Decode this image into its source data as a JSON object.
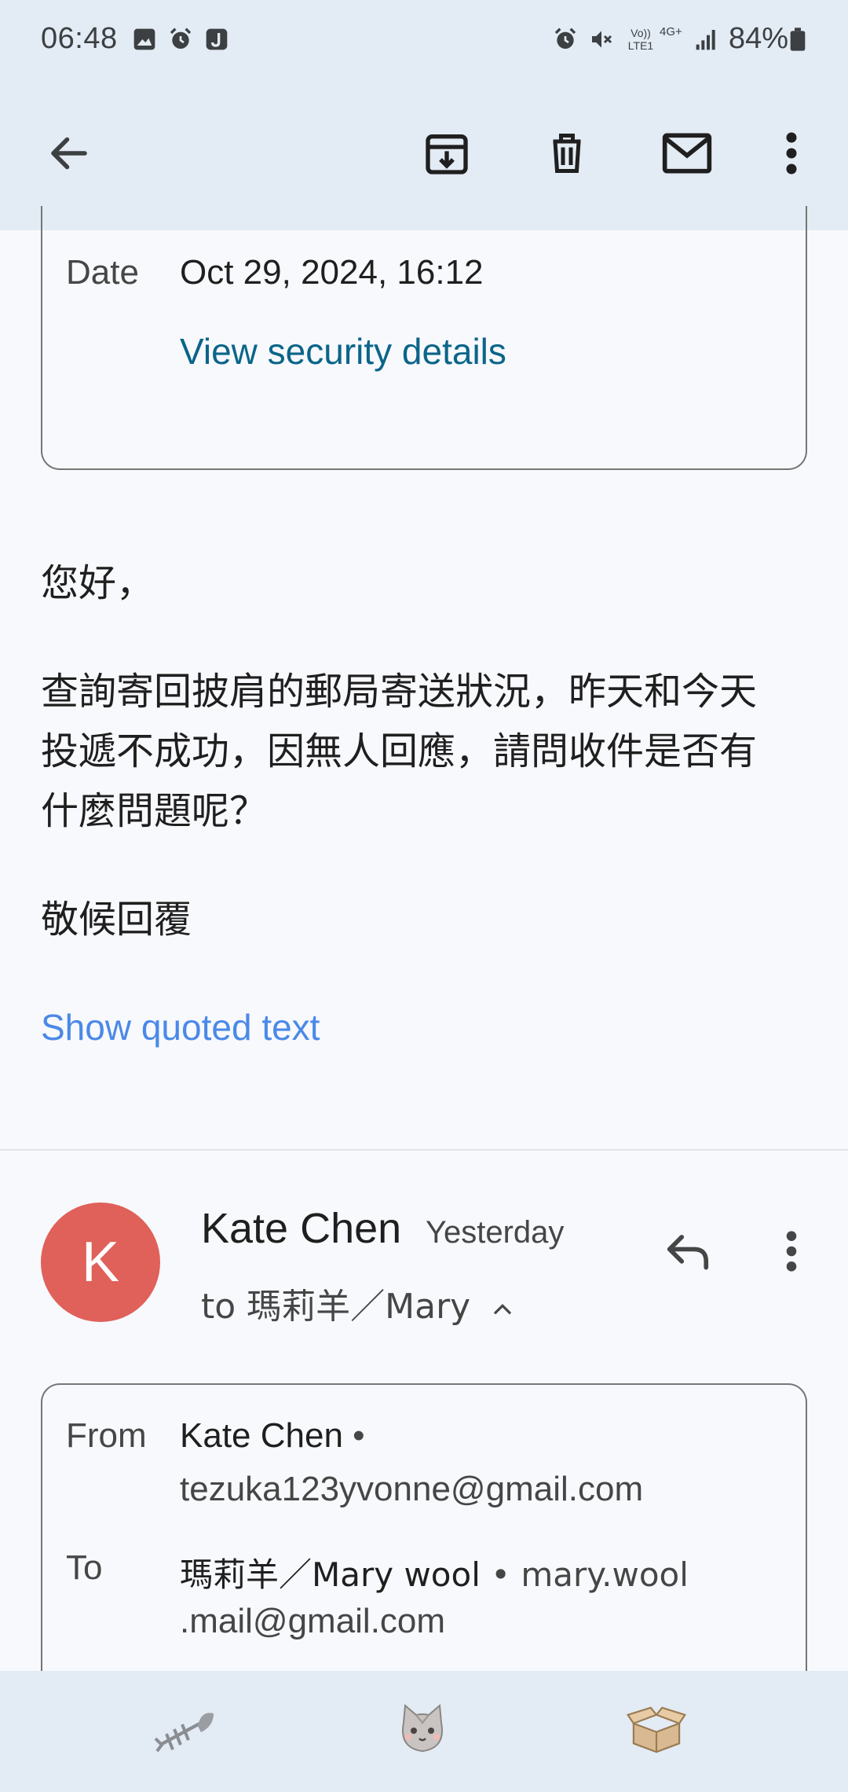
{
  "status_bar": {
    "time": "06:48",
    "battery": "84%",
    "lte_label": "Vo)) LTE1",
    "network_label": "4G+"
  },
  "toolbar": {
    "icons": [
      "back-arrow-icon",
      "archive-icon",
      "delete-icon",
      "mail-icon",
      "more-vert-icon"
    ]
  },
  "first_message": {
    "date_label": "Date",
    "date_value": "Oct 29, 2024, 16:12",
    "security_link": "View security details",
    "greeting": "您好，",
    "body_line1": "查詢寄回披肩的郵局寄送狀況，昨天和今天",
    "body_line2": "投遞不成功，因無人回應，請問收件是否有",
    "body_line3": "什麼問題呢？",
    "closing": "敬候回覆",
    "show_quoted": "Show quoted text"
  },
  "second_message": {
    "avatar_letter": "K",
    "sender": "Kate Chen",
    "time": "Yesterday",
    "to_line": "to 瑪莉羊／Mary",
    "from_label": "From",
    "from_name": "Kate Chen",
    "from_email": "tezuka123yvonne@gmail.com",
    "to_label": "To",
    "to_name": "瑪莉羊／Mary wool",
    "to_email_part1": "mary.wool",
    "to_email_part2": ".mail@gmail.com",
    "separator": "•"
  },
  "bottom_bar": {
    "icons": [
      "fish-bone-icon",
      "cat-face-icon",
      "open-box-icon"
    ]
  },
  "colors": {
    "accent_link": "#0b6589",
    "quoted_link": "#4a89e8",
    "avatar_bg": "#e0605a",
    "bar_bg": "#e3ebf4"
  }
}
